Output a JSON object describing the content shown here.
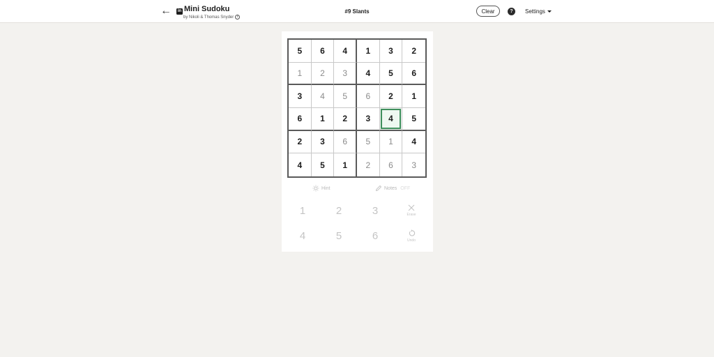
{
  "header": {
    "title": "Mini Sudoku",
    "byline": "by Nikoli & Thomas Snyder",
    "puzzle_name": "#9 Slants",
    "clear_label": "Clear",
    "help_glyph": "?",
    "settings_label": "Settings"
  },
  "board": {
    "rows": [
      [
        {
          "v": "5",
          "t": "given"
        },
        {
          "v": "6",
          "t": "given"
        },
        {
          "v": "4",
          "t": "given"
        },
        {
          "v": "1",
          "t": "given"
        },
        {
          "v": "3",
          "t": "given"
        },
        {
          "v": "2",
          "t": "given"
        }
      ],
      [
        {
          "v": "1",
          "t": "entered"
        },
        {
          "v": "2",
          "t": "entered"
        },
        {
          "v": "3",
          "t": "entered"
        },
        {
          "v": "4",
          "t": "given"
        },
        {
          "v": "5",
          "t": "given"
        },
        {
          "v": "6",
          "t": "given"
        }
      ],
      [
        {
          "v": "3",
          "t": "given"
        },
        {
          "v": "4",
          "t": "entered"
        },
        {
          "v": "5",
          "t": "entered"
        },
        {
          "v": "6",
          "t": "entered"
        },
        {
          "v": "2",
          "t": "given"
        },
        {
          "v": "1",
          "t": "given"
        }
      ],
      [
        {
          "v": "6",
          "t": "given"
        },
        {
          "v": "1",
          "t": "given"
        },
        {
          "v": "2",
          "t": "given"
        },
        {
          "v": "3",
          "t": "given"
        },
        {
          "v": "4",
          "t": "given"
        },
        {
          "v": "5",
          "t": "given"
        }
      ],
      [
        {
          "v": "2",
          "t": "given"
        },
        {
          "v": "3",
          "t": "given"
        },
        {
          "v": "6",
          "t": "entered"
        },
        {
          "v": "5",
          "t": "entered"
        },
        {
          "v": "1",
          "t": "entered"
        },
        {
          "v": "4",
          "t": "given"
        }
      ],
      [
        {
          "v": "4",
          "t": "given"
        },
        {
          "v": "5",
          "t": "given"
        },
        {
          "v": "1",
          "t": "given"
        },
        {
          "v": "2",
          "t": "entered"
        },
        {
          "v": "6",
          "t": "entered"
        },
        {
          "v": "3",
          "t": "entered"
        }
      ]
    ],
    "selected": {
      "row": 3,
      "col": 4
    },
    "accent_color": "#3f8f5d"
  },
  "tools": {
    "hint_label": "Hint",
    "notes_label": "Notes",
    "notes_state": "OFF"
  },
  "keypad": {
    "numbers": [
      "1",
      "2",
      "3",
      "4",
      "5",
      "6"
    ],
    "erase_label": "Erase",
    "undo_label": "Undo"
  }
}
